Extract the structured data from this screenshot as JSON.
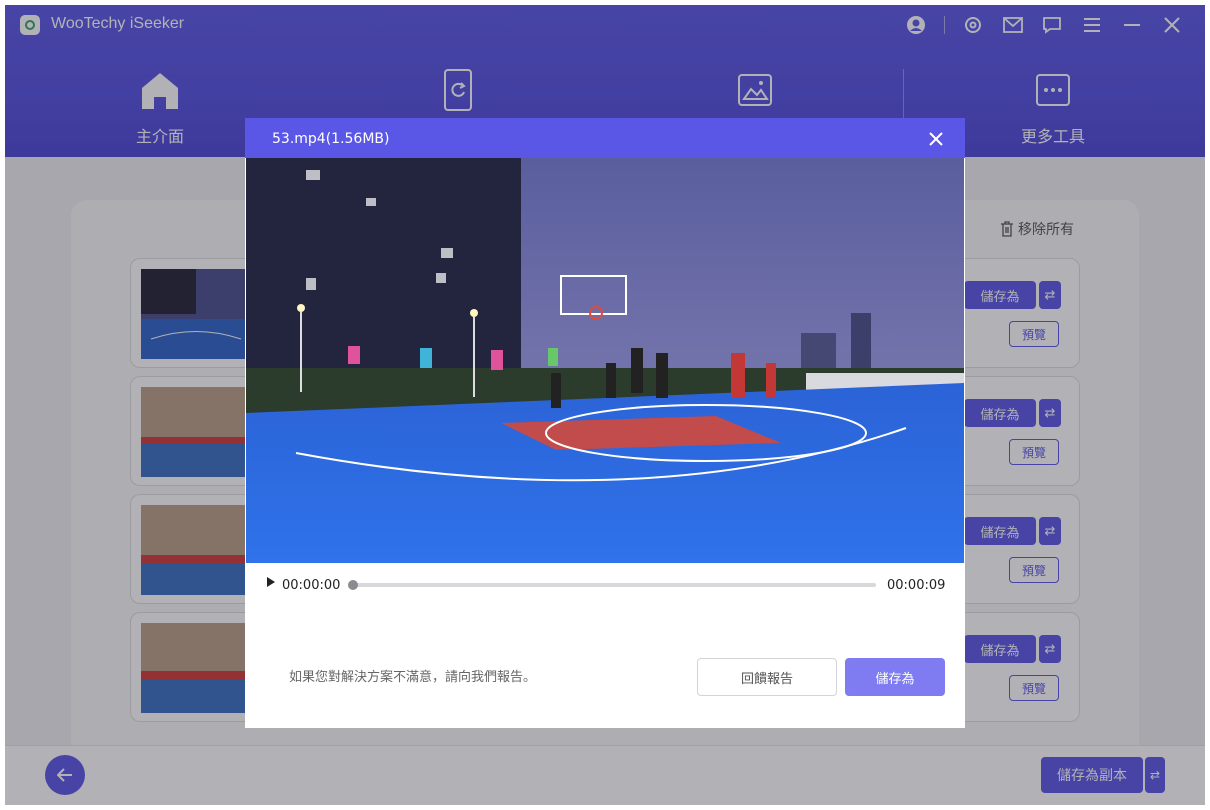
{
  "app": {
    "title": "WooTechy iSeeker"
  },
  "nav": {
    "items": [
      {
        "label": "主介面",
        "icon": "home-icon"
      },
      {
        "label": "",
        "icon": "recover-icon"
      },
      {
        "label": "",
        "icon": "photo-icon"
      },
      {
        "label": "更多工具",
        "icon": "more-icon"
      }
    ]
  },
  "content": {
    "remove_all": "移除所有",
    "rows": [
      {
        "save_label": "儲存為",
        "swap_label": "⇄",
        "preview_label": "預覽"
      },
      {
        "save_label": "儲存為",
        "swap_label": "⇄",
        "preview_label": "預覽"
      },
      {
        "save_label": "儲存為",
        "swap_label": "⇄",
        "preview_label": "預覽"
      },
      {
        "save_label": "儲存為",
        "swap_label": "⇄",
        "preview_label": "預覽"
      }
    ]
  },
  "footer": {
    "save_copy_label": "儲存為副本",
    "swap_label": "⇄"
  },
  "modal": {
    "title": "53.mp4(1.56MB)",
    "current_time": "00:00:00",
    "duration": "00:00:09",
    "progress": 0,
    "hint": "如果您對解決方案不滿意，請向我們報告。",
    "report_label": "回饋報告",
    "save_label": "儲存為"
  },
  "colors": {
    "accent": "#5b57e6",
    "accent_light": "#7f7cf1"
  }
}
